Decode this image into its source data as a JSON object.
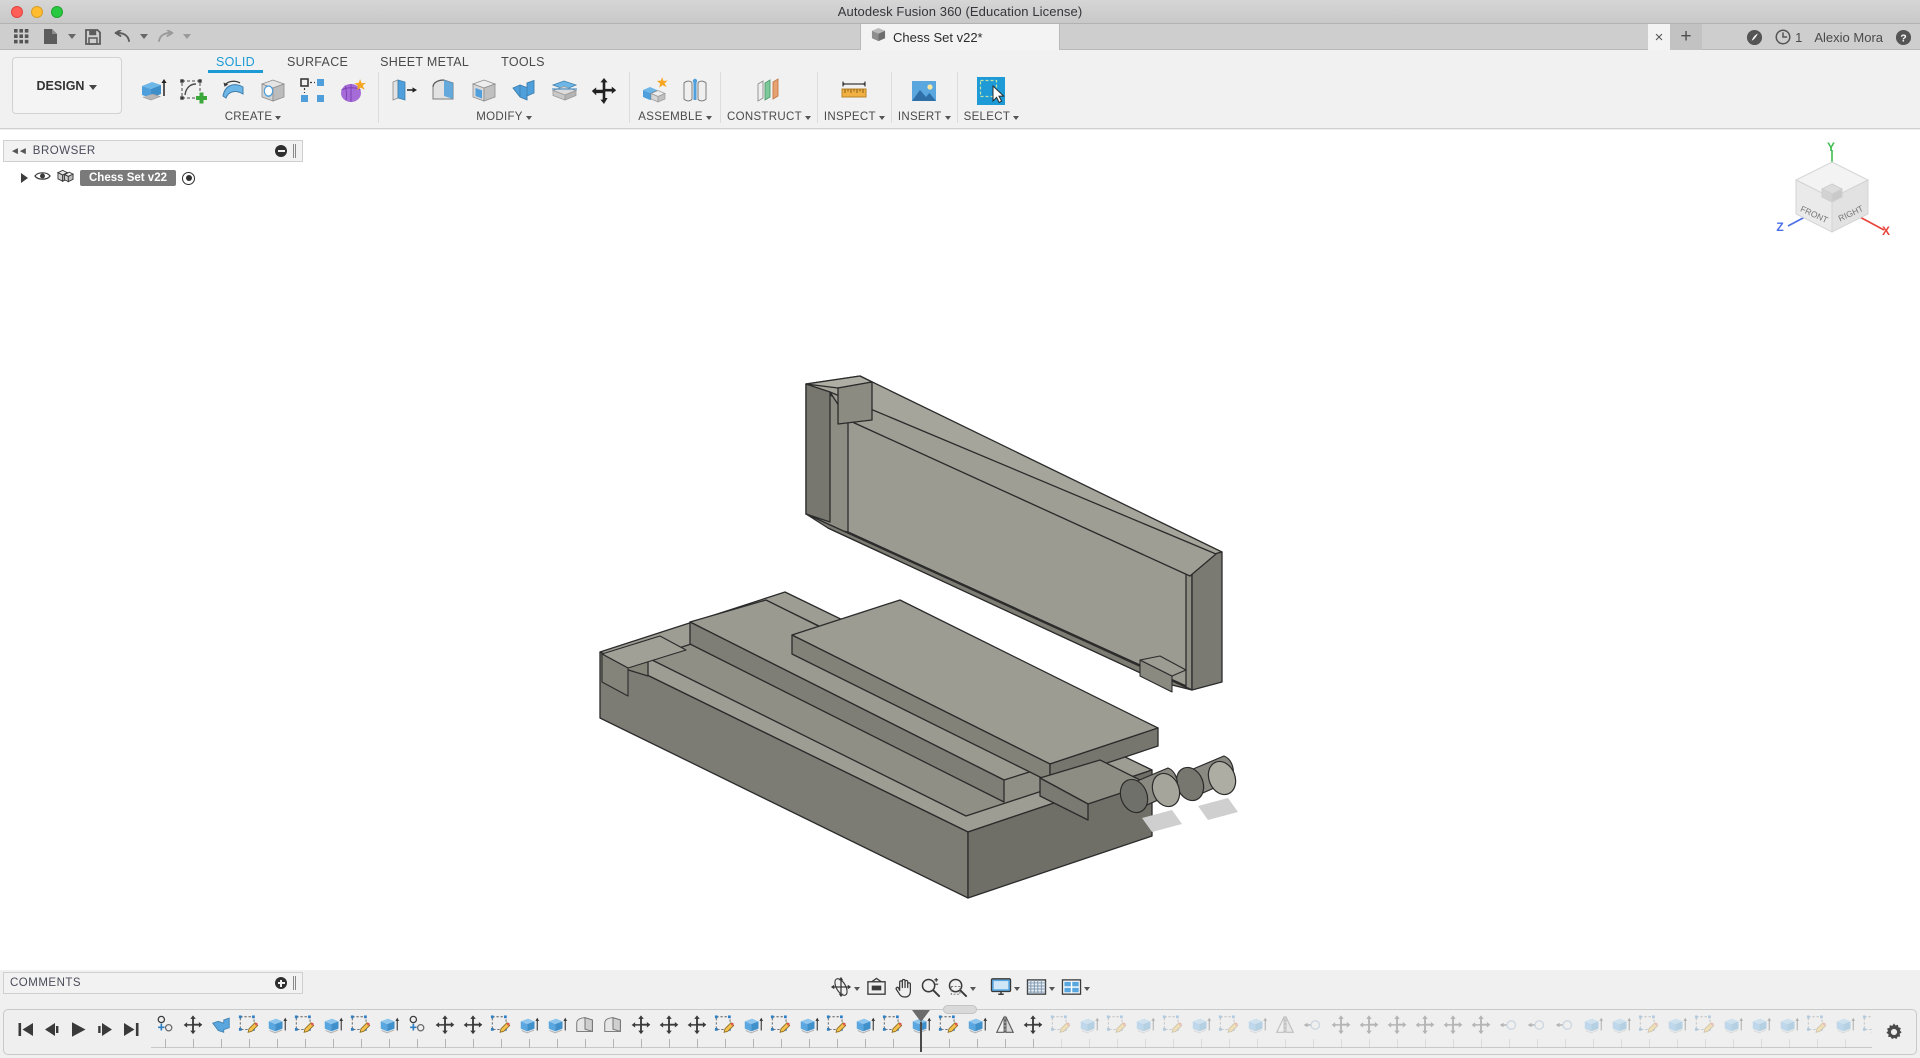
{
  "window": {
    "title": "Autodesk Fusion 360 (Education License)",
    "traffic_lights": [
      "close",
      "minimize",
      "zoom"
    ]
  },
  "quick_access": {
    "items": [
      {
        "name": "app-grid-icon",
        "label": "Show Data Panel"
      },
      {
        "name": "new-file-icon",
        "label": "New Design"
      },
      {
        "name": "save-icon",
        "label": "Save"
      },
      {
        "name": "undo-icon",
        "label": "Undo"
      },
      {
        "name": "redo-icon",
        "label": "Redo"
      }
    ]
  },
  "document_tab": {
    "title": "Chess Set v22*",
    "icon": "cube-icon",
    "close_label": "×",
    "new_tab_label": "+"
  },
  "account_bar": {
    "extensions_label": "",
    "notification_count": "1",
    "user_name": "Alexio Mora",
    "help_label": "?"
  },
  "ribbon": {
    "workspace_button": "DESIGN",
    "tabs": [
      {
        "label": "SOLID",
        "active": true
      },
      {
        "label": "SURFACE",
        "active": false
      },
      {
        "label": "SHEET METAL",
        "active": false
      },
      {
        "label": "TOOLS",
        "active": false
      }
    ],
    "panels": [
      {
        "label": "CREATE",
        "has_dropdown": true,
        "tools": [
          {
            "name": "extrude-icon",
            "label": "Extrude"
          },
          {
            "name": "create-sketch-icon",
            "label": "Create Sketch"
          },
          {
            "name": "revolve-icon",
            "label": "Revolve"
          },
          {
            "name": "hole-icon",
            "label": "Hole"
          },
          {
            "name": "pattern-icon",
            "label": "Rectangular Pattern"
          },
          {
            "name": "create-form-icon",
            "label": "Create Form"
          }
        ]
      },
      {
        "label": "MODIFY",
        "has_dropdown": true,
        "tools": [
          {
            "name": "press-pull-icon",
            "label": "Press Pull"
          },
          {
            "name": "fillet-icon",
            "label": "Fillet"
          },
          {
            "name": "shell-icon",
            "label": "Shell"
          },
          {
            "name": "combine-icon",
            "label": "Combine"
          },
          {
            "name": "split-face-icon",
            "label": "Split Face"
          },
          {
            "name": "move-copy-icon",
            "label": "Move/Copy"
          }
        ]
      },
      {
        "label": "ASSEMBLE",
        "has_dropdown": true,
        "tools": [
          {
            "name": "new-component-icon",
            "label": "New Component"
          },
          {
            "name": "joint-icon",
            "label": "Joint"
          }
        ]
      },
      {
        "label": "CONSTRUCT",
        "has_dropdown": true,
        "tools": [
          {
            "name": "construction-plane-icon",
            "label": "Offset Plane"
          }
        ]
      },
      {
        "label": "INSPECT",
        "has_dropdown": true,
        "tools": [
          {
            "name": "measure-icon",
            "label": "Measure"
          }
        ]
      },
      {
        "label": "INSERT",
        "has_dropdown": true,
        "tools": [
          {
            "name": "insert-image-icon",
            "label": "Insert Canvas"
          }
        ]
      },
      {
        "label": "SELECT",
        "has_dropdown": true,
        "tools": [
          {
            "name": "select-icon",
            "label": "Select"
          }
        ]
      }
    ]
  },
  "browser": {
    "title": "BROWSER",
    "collapse_icon": "collapse-left-icon",
    "minimize_icon": "minus-circle-icon",
    "root": {
      "expand_icon": "expand-triangle-icon",
      "visibility_icon": "eye-icon",
      "component_icon": "component-icon",
      "label": "Chess Set v22",
      "activate_icon": "radio-dot-icon",
      "selected": true
    }
  },
  "comments": {
    "title": "COMMENTS",
    "add_icon": "plus-circle-icon"
  },
  "viewcube": {
    "front_label": "FRONT",
    "right_label": "RIGHT",
    "axes": [
      {
        "label": "X",
        "color": "#e8453c"
      },
      {
        "label": "Y",
        "color": "#3fbd4f"
      },
      {
        "label": "Z",
        "color": "#4a6fe8"
      }
    ]
  },
  "navbar": {
    "items": [
      {
        "name": "orbit-icon",
        "label": "Orbit",
        "caret": true
      },
      {
        "name": "look-at-icon",
        "label": "Look At",
        "caret": false
      },
      {
        "name": "pan-icon",
        "label": "Pan",
        "caret": false
      },
      {
        "name": "zoom-icon",
        "label": "Zoom",
        "caret": false
      },
      {
        "name": "fit-icon",
        "label": "Fit",
        "caret": true
      },
      {
        "name": "display-settings-icon",
        "label": "Display Settings",
        "caret": true
      },
      {
        "name": "grid-snap-icon",
        "label": "Grid and Snaps",
        "caret": true
      },
      {
        "name": "viewports-icon",
        "label": "Viewports",
        "caret": true
      }
    ]
  },
  "timeline": {
    "playback": [
      {
        "name": "go-to-beginning-icon",
        "label": "Go to beginning"
      },
      {
        "name": "step-back-icon",
        "label": "Step back"
      },
      {
        "name": "play-icon",
        "label": "Play"
      },
      {
        "name": "step-forward-icon",
        "label": "Step forward"
      },
      {
        "name": "go-to-end-icon",
        "label": "Go to end"
      }
    ],
    "settings_icon": "gear-icon",
    "playhead_index": 27,
    "features": [
      {
        "type": "new-component",
        "past": true
      },
      {
        "type": "move-copy",
        "past": true
      },
      {
        "type": "combine",
        "past": true
      },
      {
        "type": "sketch",
        "past": true
      },
      {
        "type": "extrude",
        "past": true
      },
      {
        "type": "sketch",
        "past": true
      },
      {
        "type": "extrude",
        "past": true
      },
      {
        "type": "sketch",
        "past": true
      },
      {
        "type": "extrude",
        "past": true
      },
      {
        "type": "new-component",
        "past": true
      },
      {
        "type": "move-copy",
        "past": true
      },
      {
        "type": "move-copy",
        "past": true
      },
      {
        "type": "sketch",
        "past": true
      },
      {
        "type": "extrude",
        "past": true
      },
      {
        "type": "extrude",
        "past": true
      },
      {
        "type": "fillet",
        "past": true
      },
      {
        "type": "fillet",
        "past": true
      },
      {
        "type": "move-copy",
        "past": true
      },
      {
        "type": "move-copy",
        "past": true
      },
      {
        "type": "move-copy",
        "past": true
      },
      {
        "type": "sketch",
        "past": true
      },
      {
        "type": "extrude",
        "past": true
      },
      {
        "type": "sketch",
        "past": true
      },
      {
        "type": "extrude",
        "past": true
      },
      {
        "type": "sketch",
        "past": true
      },
      {
        "type": "extrude",
        "past": true
      },
      {
        "type": "sketch",
        "past": true
      },
      {
        "type": "extrude",
        "past": true
      },
      {
        "type": "sketch",
        "past": true
      },
      {
        "type": "extrude",
        "past": true
      },
      {
        "type": "mirror",
        "past": true
      },
      {
        "type": "move-copy",
        "past": true
      },
      {
        "type": "sketch",
        "past": false
      },
      {
        "type": "extrude",
        "past": false
      },
      {
        "type": "sketch",
        "past": false
      },
      {
        "type": "extrude",
        "past": false
      },
      {
        "type": "sketch",
        "past": false
      },
      {
        "type": "extrude",
        "past": false
      },
      {
        "type": "sketch",
        "past": false
      },
      {
        "type": "extrude",
        "past": false
      },
      {
        "type": "mirror",
        "past": false
      },
      {
        "type": "joint",
        "past": false
      },
      {
        "type": "move-copy",
        "past": false
      },
      {
        "type": "move-copy",
        "past": false
      },
      {
        "type": "move-copy",
        "past": false
      },
      {
        "type": "move-copy",
        "past": false
      },
      {
        "type": "move-copy",
        "past": false
      },
      {
        "type": "move-copy",
        "past": false
      },
      {
        "type": "joint",
        "past": false
      },
      {
        "type": "joint",
        "past": false
      },
      {
        "type": "joint",
        "past": false
      },
      {
        "type": "extrude",
        "past": false
      },
      {
        "type": "extrude",
        "past": false
      },
      {
        "type": "sketch",
        "past": false
      },
      {
        "type": "extrude",
        "past": false
      },
      {
        "type": "sketch",
        "past": false
      },
      {
        "type": "extrude",
        "past": false
      },
      {
        "type": "extrude",
        "past": false
      },
      {
        "type": "extrude",
        "past": false
      },
      {
        "type": "sketch",
        "past": false
      },
      {
        "type": "extrude",
        "past": false
      },
      {
        "type": "sketch",
        "past": false
      },
      {
        "type": "extrude",
        "past": false
      },
      {
        "type": "extrude",
        "past": false
      },
      {
        "type": "extrude",
        "past": false
      },
      {
        "type": "sketch",
        "past": false
      }
    ]
  },
  "model": {
    "description": "Chess set storage box shown open: rectangular base tray with internal compartment ridges and an upright hinged lid, joined by two cylindrical hinge pins at the lower right.",
    "shading_color": "#8a8a80",
    "edge_color": "#2b2b2b",
    "background_color": "#ffffff"
  }
}
